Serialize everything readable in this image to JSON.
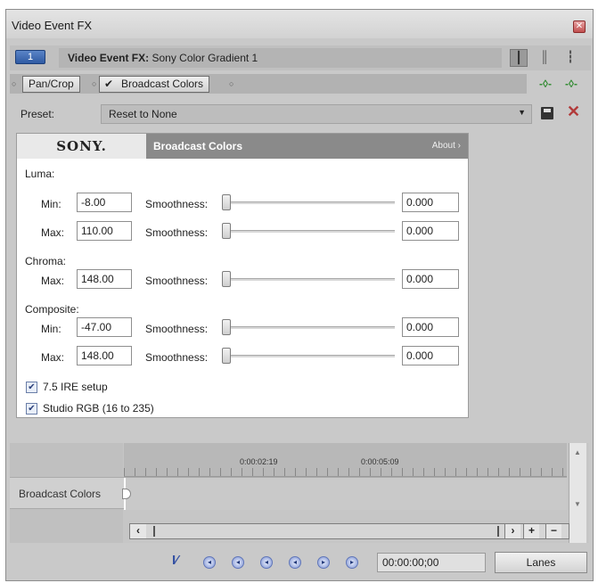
{
  "window": {
    "title": "Video Event FX"
  },
  "fx_header": {
    "event_number": "1",
    "label_prefix": "Video Event FX:",
    "label_value": "Sony Color Gradient 1"
  },
  "chain": {
    "items": [
      {
        "label": "Pan/Crop"
      },
      {
        "label": "Broadcast Colors"
      }
    ]
  },
  "preset": {
    "label": "Preset:",
    "value": "Reset to None"
  },
  "plugin": {
    "brand": "SONY.",
    "name": "Broadcast Colors",
    "about": "About"
  },
  "sections": {
    "luma": "Luma:",
    "chroma": "Chroma:",
    "composite": "Composite:"
  },
  "controls": {
    "smoothness_label": "Smoothness:",
    "luma_min": {
      "label": "Min:",
      "value": "-8.00",
      "smoothness": "0.000"
    },
    "luma_max": {
      "label": "Max:",
      "value": "110.00",
      "smoothness": "0.000"
    },
    "chroma_max": {
      "label": "Max:",
      "value": "148.00",
      "smoothness": "0.000"
    },
    "composite_min": {
      "label": "Min:",
      "value": "-47.00",
      "smoothness": "0.000"
    },
    "composite_max": {
      "label": "Max:",
      "value": "148.00",
      "smoothness": "0.000"
    }
  },
  "checkboxes": {
    "ire": {
      "label": "7.5 IRE setup",
      "checked": true
    },
    "studio_rgb": {
      "label": "Studio RGB (16 to 235)",
      "checked": true
    }
  },
  "timeline": {
    "ticks": [
      "0:00:02:19",
      "0:00:05:09"
    ],
    "track_label": "Broadcast Colors"
  },
  "footer": {
    "timecode": "00:00:00;00",
    "lanes_label": "Lanes"
  },
  "colors": {
    "accent_blue": "#2f5aa3",
    "delete_red": "#b23b3b",
    "chain_green": "#2f8a2f"
  }
}
